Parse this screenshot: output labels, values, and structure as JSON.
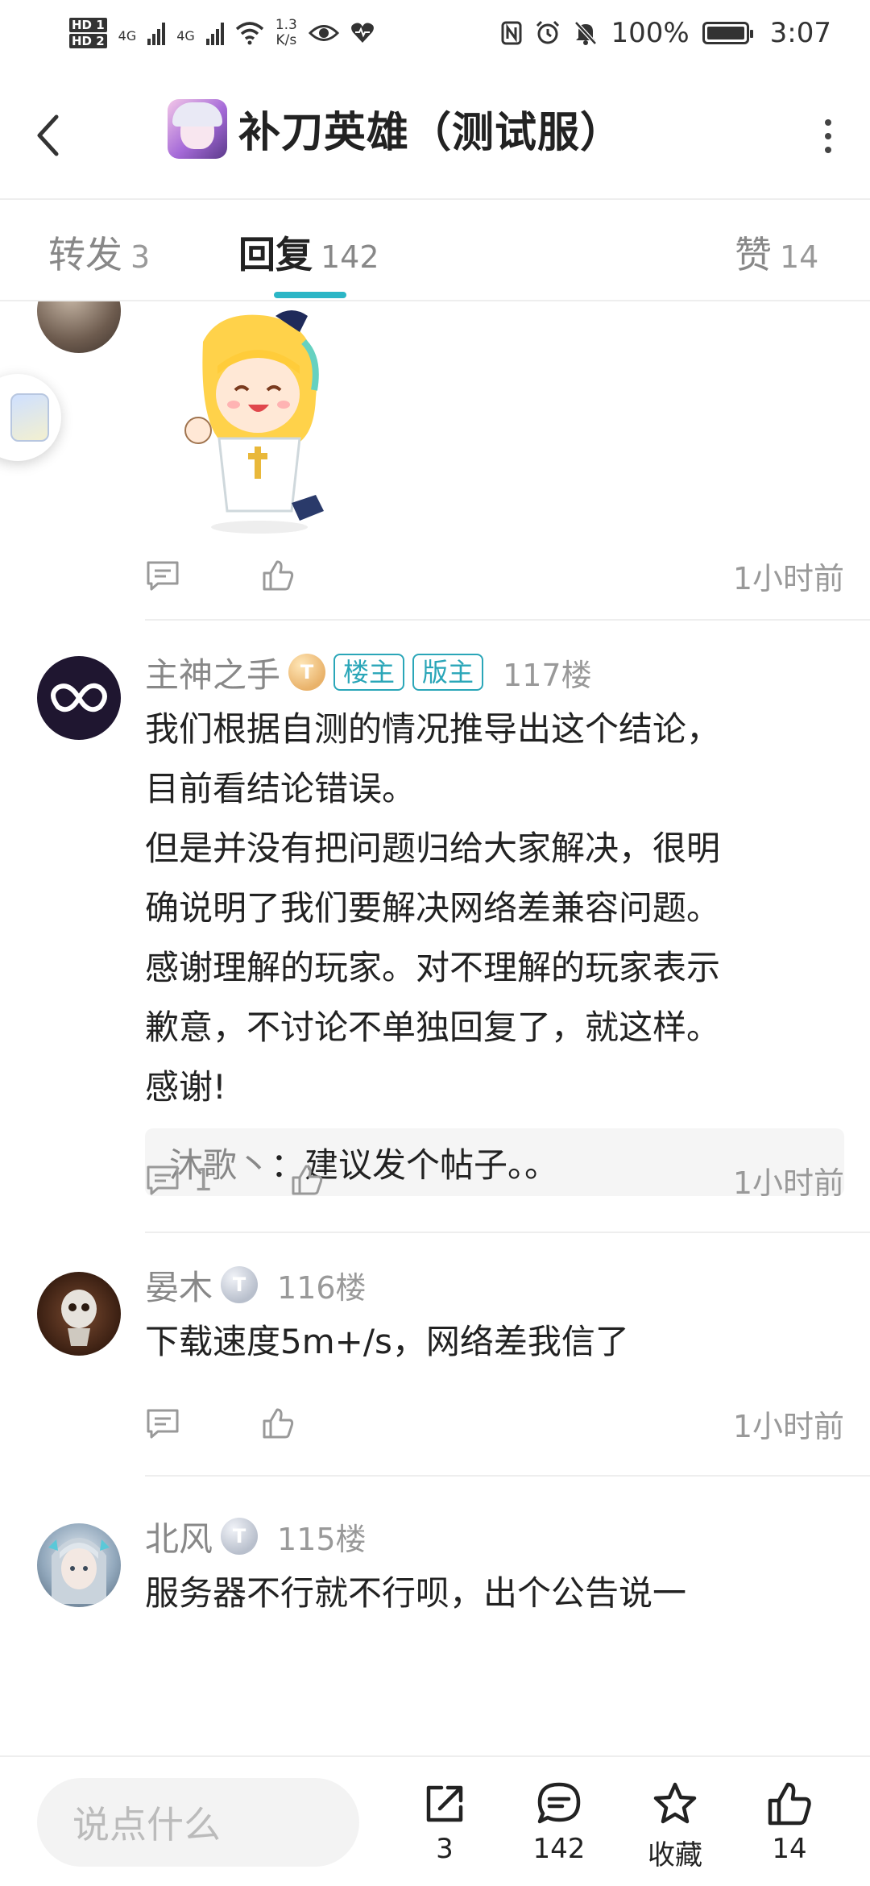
{
  "status_bar": {
    "hd1": "HD 1",
    "hd2": "HD 2",
    "net1": "4G",
    "net2": "4G",
    "speed_value": "1.3",
    "speed_unit": "K/s",
    "battery": "100%",
    "time": "3:07"
  },
  "header": {
    "title": "补刀英雄（测试服）"
  },
  "tabs": [
    {
      "label": "转发",
      "count": "3"
    },
    {
      "label": "回复",
      "count": "142"
    },
    {
      "label": "赞",
      "count": "14"
    }
  ],
  "comments": [
    {
      "time": "1小时前",
      "has_sticker": true
    },
    {
      "user": "主神之手",
      "level": "T",
      "badges": [
        "楼主",
        "版主"
      ],
      "floor": "117楼",
      "text": "我们根据自测的情况推导出这个结论，\n目前看结论错误。\n但是并没有把问题归给大家解决，很明\n确说明了我们要解决网络差兼容问题。\n感谢理解的玩家。对不理解的玩家表示\n歉意，不讨论不单独回复了，就这样。\n感谢!",
      "reply": {
        "name": "沐歌丶",
        "text": "：建议发个帖子。。"
      },
      "reply_count": "1",
      "time": "1小时前"
    },
    {
      "user": "晏木",
      "level": "T",
      "floor": "116楼",
      "text": "下载速度5m+/s，网络差我信了",
      "time": "1小时前"
    },
    {
      "user": "北风",
      "level": "T",
      "floor": "115楼",
      "text": "服务器不行就不行呗，出个公告说一"
    }
  ],
  "bottom_bar": {
    "input_placeholder": "说点什么",
    "share_count": "3",
    "comment_count": "142",
    "favorite_label": "收藏",
    "like_count": "14"
  }
}
